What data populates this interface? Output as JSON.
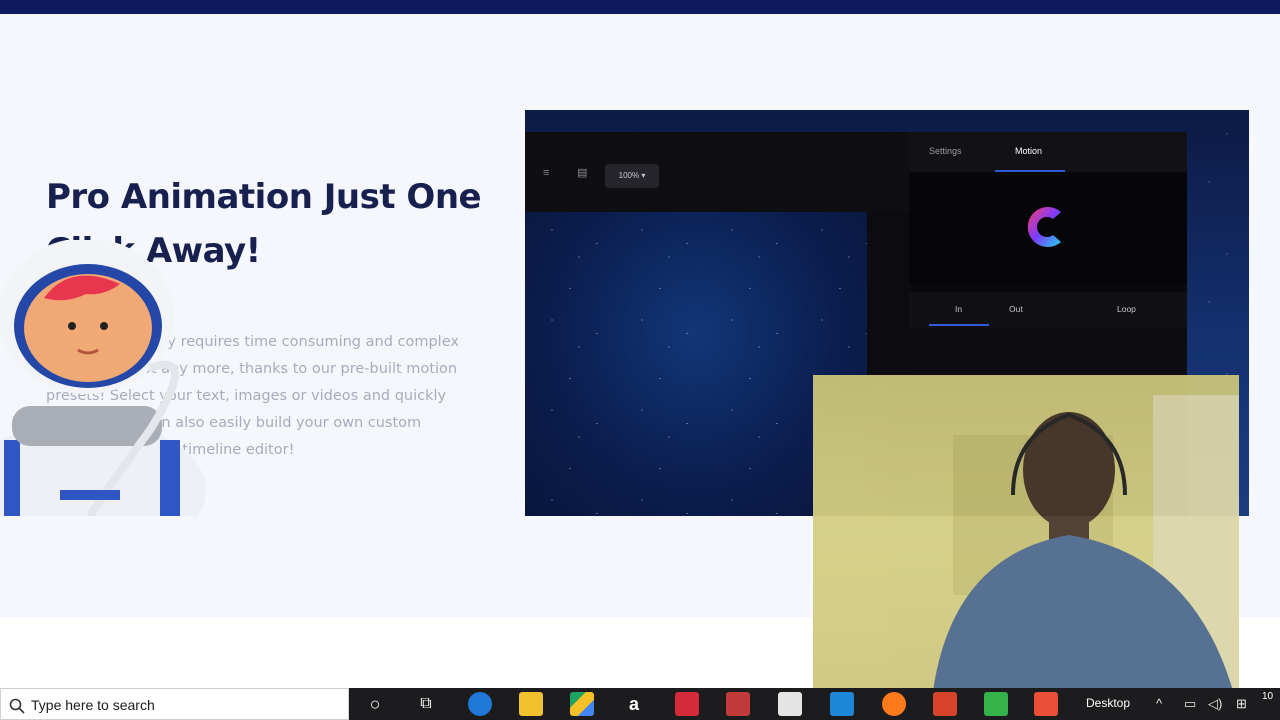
{
  "hero": {
    "headline": "Pro Animation Just One Click Away!",
    "description": "Animation usually requires time consuming and complex keyframes. Not any more, thanks to our pre-built motion presets! Select your text, images or videos and quickly animate. You can also easily build your own custom animations on our timeline editor!"
  },
  "editor": {
    "zoom": "100% ▾",
    "tabs": [
      {
        "label": "Settings"
      },
      {
        "label": "Motion"
      }
    ],
    "subtabs": [
      {
        "label": "In"
      },
      {
        "label": "Out"
      },
      {
        "label": "Loop"
      }
    ]
  },
  "taskbar": {
    "search_placeholder": "Type here to search",
    "desktop_label": "Desktop",
    "clock": "10"
  },
  "colors": {
    "accent_blue": "#2f5bd6",
    "headline": "#17204f",
    "taskbar": "#1c1c1f"
  }
}
